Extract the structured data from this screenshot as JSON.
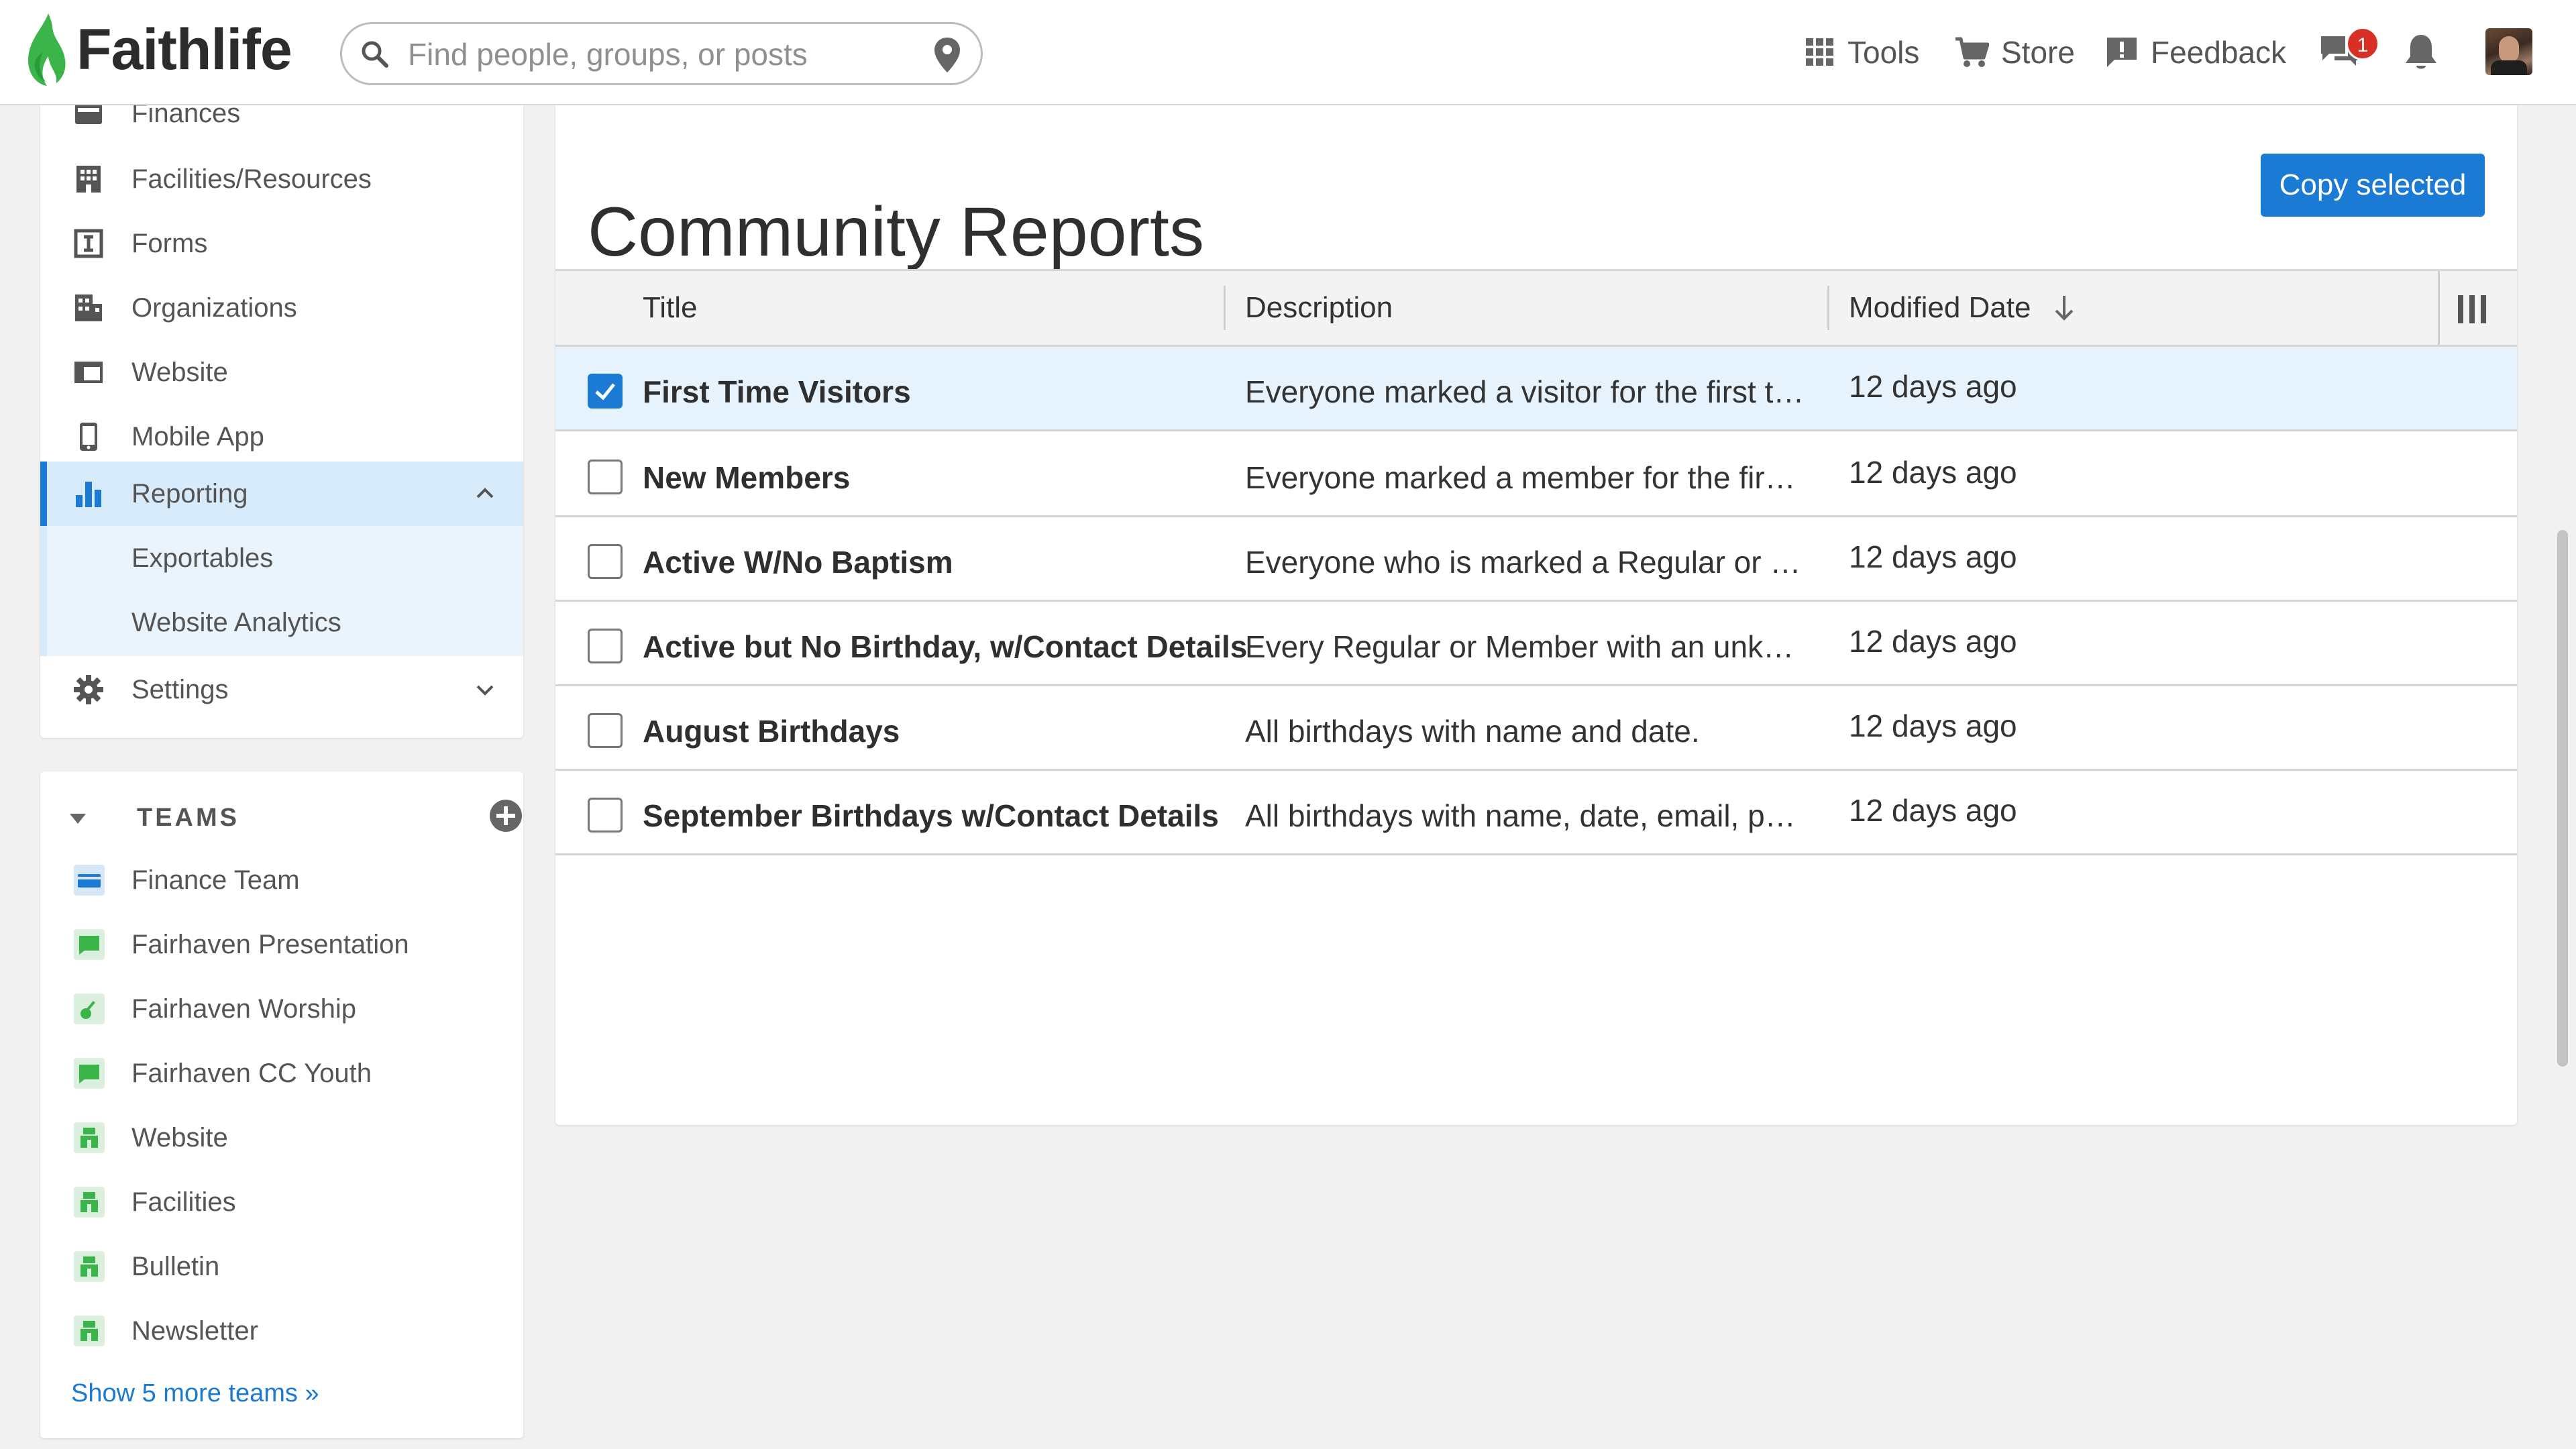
{
  "header": {
    "logo_text": "Faithlife",
    "search_placeholder": "Find people, groups, or posts",
    "nav": [
      {
        "label": "Tools",
        "icon": "grid-icon"
      },
      {
        "label": "Store",
        "icon": "cart-icon"
      },
      {
        "label": "Feedback",
        "icon": "feedback-icon"
      }
    ],
    "messages_badge": "1"
  },
  "sidebar": {
    "items": [
      {
        "label": "Finances",
        "icon": "finances-icon"
      },
      {
        "label": "Facilities/Resources",
        "icon": "building-icon"
      },
      {
        "label": "Forms",
        "icon": "form-icon"
      },
      {
        "label": "Organizations",
        "icon": "organization-icon"
      },
      {
        "label": "Website",
        "icon": "website-icon"
      },
      {
        "label": "Mobile App",
        "icon": "mobile-icon"
      },
      {
        "label": "Reporting",
        "icon": "bar-chart-icon",
        "active": true
      },
      {
        "label": "Settings",
        "icon": "gear-icon"
      }
    ],
    "reporting_sub": [
      "Exportables",
      "Website Analytics"
    ]
  },
  "teams": {
    "heading": "TEAMS",
    "items": [
      {
        "label": "Finance Team",
        "color": "#1a7ad4"
      },
      {
        "label": "Fairhaven Presentation",
        "color": "#3bb54a"
      },
      {
        "label": "Fairhaven Worship",
        "color": "#3bb54a"
      },
      {
        "label": "Fairhaven CC Youth",
        "color": "#3bb54a"
      },
      {
        "label": "Website",
        "color": "#3bb54a"
      },
      {
        "label": "Facilities",
        "color": "#3bb54a"
      },
      {
        "label": "Bulletin",
        "color": "#3bb54a"
      },
      {
        "label": "Newsletter",
        "color": "#3bb54a"
      }
    ],
    "show_more": "Show 5 more teams »"
  },
  "main": {
    "title": "Community Reports",
    "copy_button": "Copy selected",
    "columns": [
      "Title",
      "Description",
      "Modified Date"
    ],
    "rows": [
      {
        "title": "First Time Visitors",
        "description": "Everyone marked a visitor for the first time",
        "modified": "12 days ago",
        "selected": true
      },
      {
        "title": "New Members",
        "description": "Everyone marked a member for the first time",
        "modified": "12 days ago",
        "selected": false
      },
      {
        "title": "Active W/No Baptism",
        "description": "Everyone who is marked a Regular or Member",
        "modified": "12 days ago",
        "selected": false
      },
      {
        "title": "Active but No Birthday, w/Contact Details",
        "description": "Every Regular or Member with an unknown birthday",
        "modified": "12 days ago",
        "selected": false
      },
      {
        "title": "August Birthdays",
        "description": "All birthdays with name and date.",
        "modified": "12 days ago",
        "selected": false
      },
      {
        "title": "September Birthdays w/Contact Details",
        "description": "All birthdays with name, date, email, phone",
        "modified": "12 days ago",
        "selected": false
      }
    ]
  }
}
